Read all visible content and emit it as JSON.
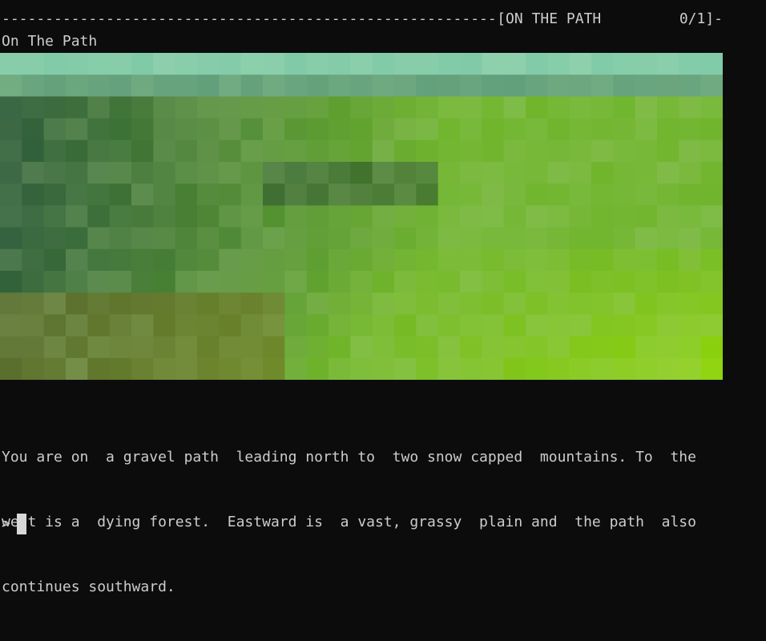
{
  "status_bar": {
    "dashes": "-----------------------------------------------------------------------------------",
    "location": "[ON THE PATH",
    "score": "0/1]-"
  },
  "location_title": "On The Path",
  "scene": {
    "description": "pixelated landscape image",
    "colors": {
      "sky": "#78c6a4",
      "forest": "#3f6b44",
      "grass": "#7fbd2e",
      "bright_grass": "#94d81a",
      "dirt": "#7c7a2e"
    }
  },
  "description_lines": [
    "You are on  a gravel path  leading north to  two snow capped  mountains. To  the",
    "west is a  dying forest.  Eastward is  a vast, grassy  plain and  the path  also",
    "continues southward."
  ],
  "prompt": {
    "glyph": ">"
  },
  "colors": {
    "background": "#0c0c0c",
    "text": "#cccccc",
    "cursor": "#d8d8d8"
  }
}
